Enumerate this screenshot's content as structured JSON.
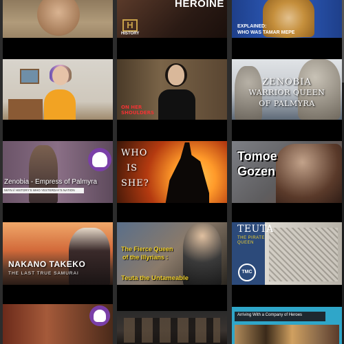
{
  "thumbnails": [
    {
      "id": "r0c0",
      "title": ""
    },
    {
      "id": "r0c1",
      "title": "HEROINE",
      "channel_logo": "H",
      "channel_label": "HISTORY"
    },
    {
      "id": "r0c2",
      "title": "EXPLAINED:",
      "subtitle": "WHO WAS TAMAR MEPE"
    },
    {
      "id": "r1c0",
      "title": ""
    },
    {
      "id": "r1c1",
      "title": "",
      "logo_line1": "ON HER",
      "logo_line2": "SHOULDERS"
    },
    {
      "id": "r1c2",
      "line1": "ZENOBIA",
      "line2": "WARRIOR QUEEN",
      "line3": "OF PALMYRA"
    },
    {
      "id": "r2c0",
      "title": "Zenobia - Empress of Palmyra",
      "subtitle": "IWYN // HISTORY'S WHO YESTERDAY'S NATION"
    },
    {
      "id": "r2c1",
      "line1": "WHO",
      "line2": "IS",
      "line3": "SHE?"
    },
    {
      "id": "r2c2",
      "line1": "Tomoe",
      "line2": "Gozen"
    },
    {
      "id": "r3c0",
      "title": "NAKANO TAKEKO",
      "subtitle": "THE LAST TRUE SAMURAI"
    },
    {
      "id": "r3c1",
      "line1": "The Fierce Queen",
      "line2": "of the Illyrians :",
      "line3": "Teuta the Untameable"
    },
    {
      "id": "r3c2",
      "title": "TEUTA",
      "subtitle_line1": "THE PIRATE",
      "subtitle_line2": "QUEEN",
      "badge": "TMC"
    },
    {
      "id": "r4c0",
      "title": ""
    },
    {
      "id": "r4c1",
      "title": ""
    },
    {
      "id": "r4c2",
      "title": "Arriving With a Company of Heroes"
    }
  ],
  "colors": {
    "background": "#2c2c2c",
    "column": "#000000",
    "accent_yellow": "#f2d22e",
    "accent_purple": "#7a3fa8",
    "accent_cyan": "#2fa6c9"
  }
}
